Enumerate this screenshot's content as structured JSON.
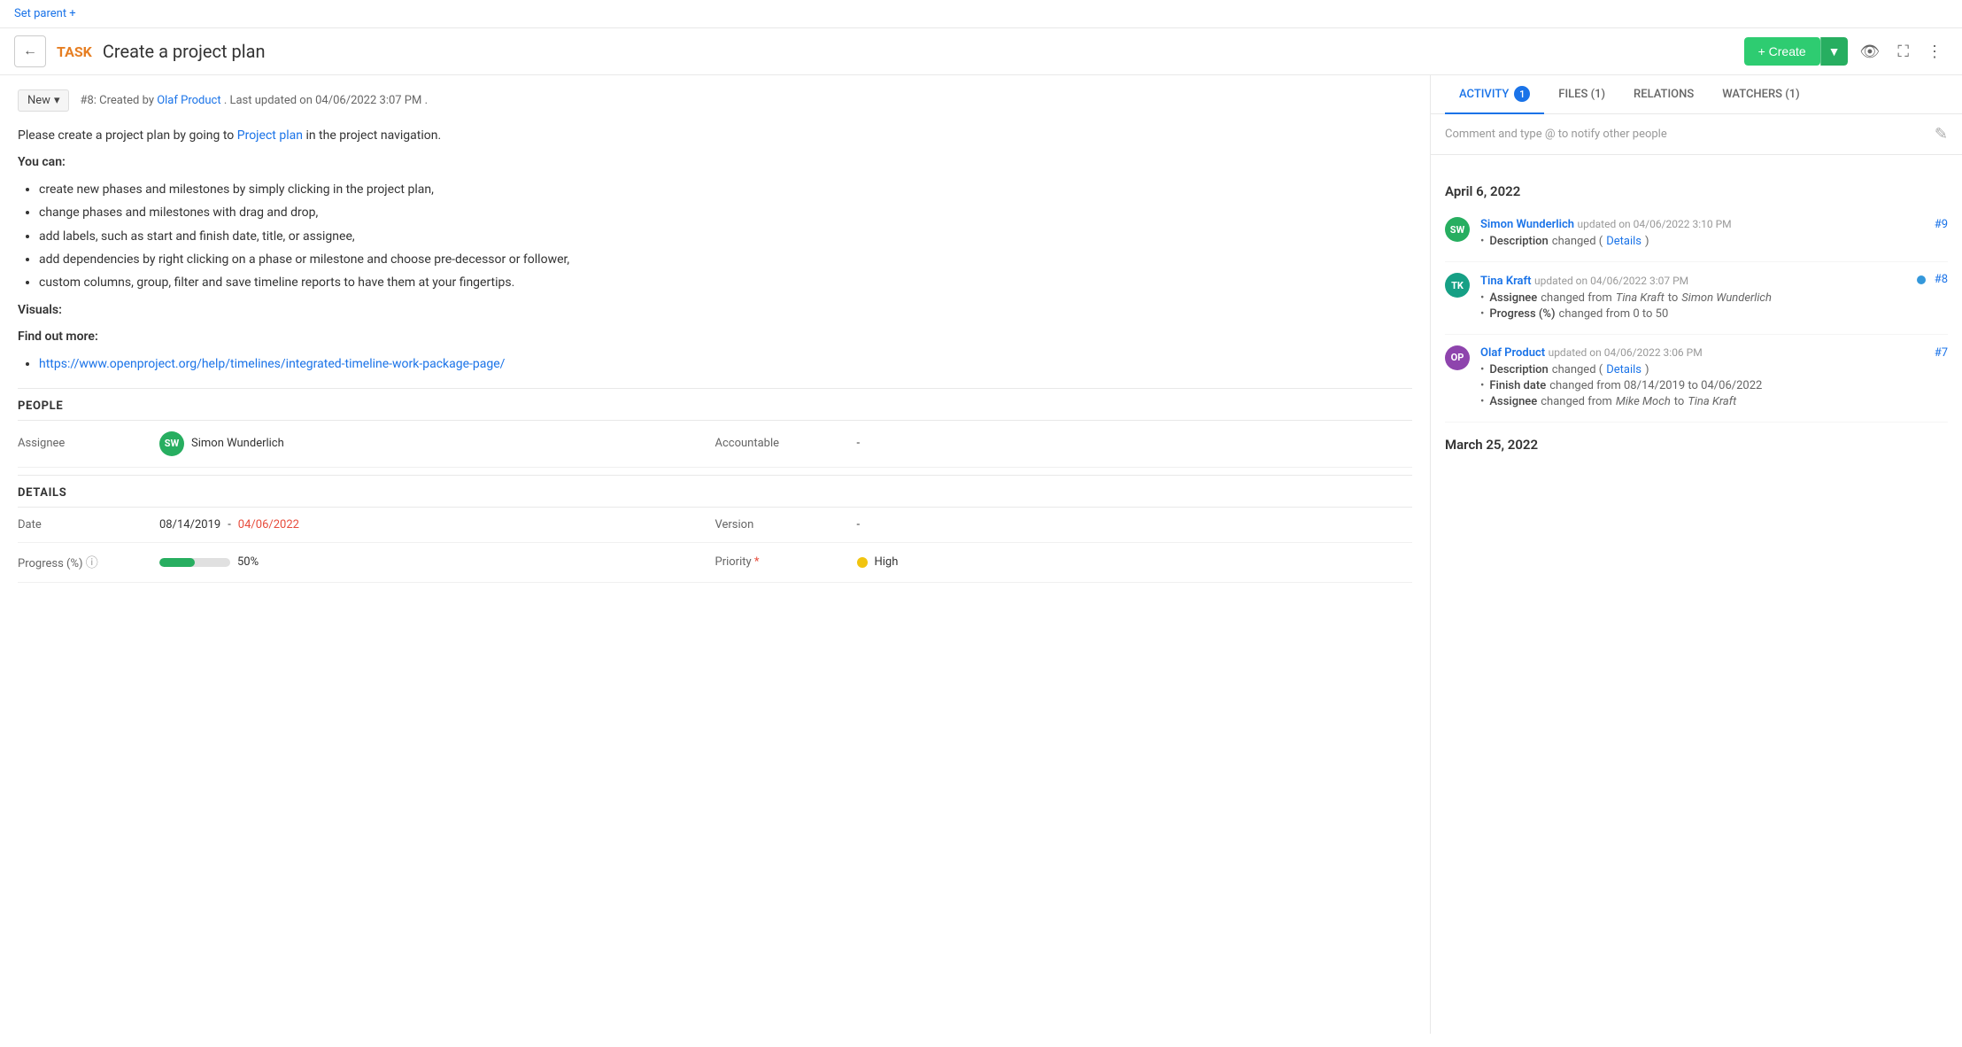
{
  "topbar": {
    "set_parent_label": "Set parent +"
  },
  "header": {
    "back_tooltip": "Back",
    "task_label": "TASK",
    "task_title": "Create a project plan",
    "create_label": "+ Create",
    "create_arrow": "▼",
    "eye_icon": "👁",
    "fullscreen_icon": "⛶",
    "more_icon": "⋮"
  },
  "status_badge": {
    "label": "New",
    "chevron": "▾"
  },
  "status_meta": {
    "number": "#8:",
    "created_text": "Created by",
    "author": "Olaf Product",
    "updated_text": ". Last updated on 04/06/2022 3:07 PM ."
  },
  "description": {
    "intro": "Please create a project plan by going to",
    "link_text": "Project plan",
    "intro_end": "in the project navigation.",
    "you_can": "You can:",
    "bullets": [
      "create new phases and milestones by simply clicking in the project plan,",
      "change phases and milestones with drag and drop,",
      "add labels, such as start and finish date, title, or assignee,",
      "add dependencies by right clicking on a phase or milestone and choose pre-decessor or follower,",
      "custom columns, group, filter and save timeline reports to have them at your fingertips."
    ],
    "visuals_label": "Visuals:",
    "find_out_more": "Find out more:",
    "url_link": "https://www.openproject.org/help/timelines/integrated-timeline-work-package-page/"
  },
  "people_section": {
    "label": "PEOPLE",
    "assignee_label": "Assignee",
    "assignee_avatar_initials": "SW",
    "assignee_name": "Simon Wunderlich",
    "accountable_label": "Accountable",
    "accountable_value": "-"
  },
  "details_section": {
    "label": "DETAILS",
    "date_label": "Date",
    "date_value_start": "08/14/2019",
    "date_separator": " - ",
    "date_value_end": "04/06/2022",
    "progress_label": "Progress (%)",
    "progress_value": 50,
    "progress_text": "50%",
    "version_label": "Version",
    "version_value": "-",
    "priority_label": "Priority",
    "priority_required": "*",
    "priority_value": "High"
  },
  "tabs": [
    {
      "id": "activity",
      "label": "ACTIVITY",
      "badge": "1",
      "active": true
    },
    {
      "id": "files",
      "label": "FILES (1)",
      "badge": null,
      "active": false
    },
    {
      "id": "relations",
      "label": "RELATIONS",
      "badge": null,
      "active": false
    },
    {
      "id": "watchers",
      "label": "WATCHERS (1)",
      "badge": null,
      "active": false
    }
  ],
  "comment_placeholder": "Comment and type @ to notify other people",
  "activity": {
    "date_groups": [
      {
        "date": "April 6, 2022",
        "entries": [
          {
            "id": "#9",
            "avatar_initials": "SW",
            "avatar_color": "green",
            "name": "Simon Wunderlich",
            "time": "updated on 04/06/2022 3:10 PM",
            "has_blue_dot": false,
            "changes": [
              {
                "key": "Description",
                "text": "changed (",
                "link": "Details",
                "after": ")"
              }
            ]
          },
          {
            "id": "#8",
            "avatar_initials": "TK",
            "avatar_color": "teal",
            "name": "Tina Kraft",
            "time": "updated on 04/06/2022 3:07 PM",
            "has_blue_dot": true,
            "changes": [
              {
                "key": "Assignee",
                "text": "changed from ",
                "italic_from": "Tina Kraft",
                "text2": " to ",
                "italic_to": "Simon Wunderlich",
                "link": null
              },
              {
                "key": "Progress (%)",
                "text": "changed from 0 to 50",
                "link": null
              }
            ]
          },
          {
            "id": "#7",
            "avatar_initials": "OP",
            "avatar_color": "purple",
            "name": "Olaf Product",
            "time": "updated on 04/06/2022 3:06 PM",
            "has_blue_dot": false,
            "changes": [
              {
                "key": "Description",
                "text": "changed (",
                "link": "Details",
                "after": ")"
              },
              {
                "key": "Finish date",
                "text": "changed from 08/14/2019 to 04/06/2022",
                "link": null
              },
              {
                "key": "Assignee",
                "text": "changed from ",
                "italic_from": "Mike Moch",
                "text2": " to ",
                "italic_to": "Tina Kraft",
                "link": null
              }
            ]
          }
        ]
      },
      {
        "date": "March 25, 2022",
        "entries": []
      }
    ]
  }
}
